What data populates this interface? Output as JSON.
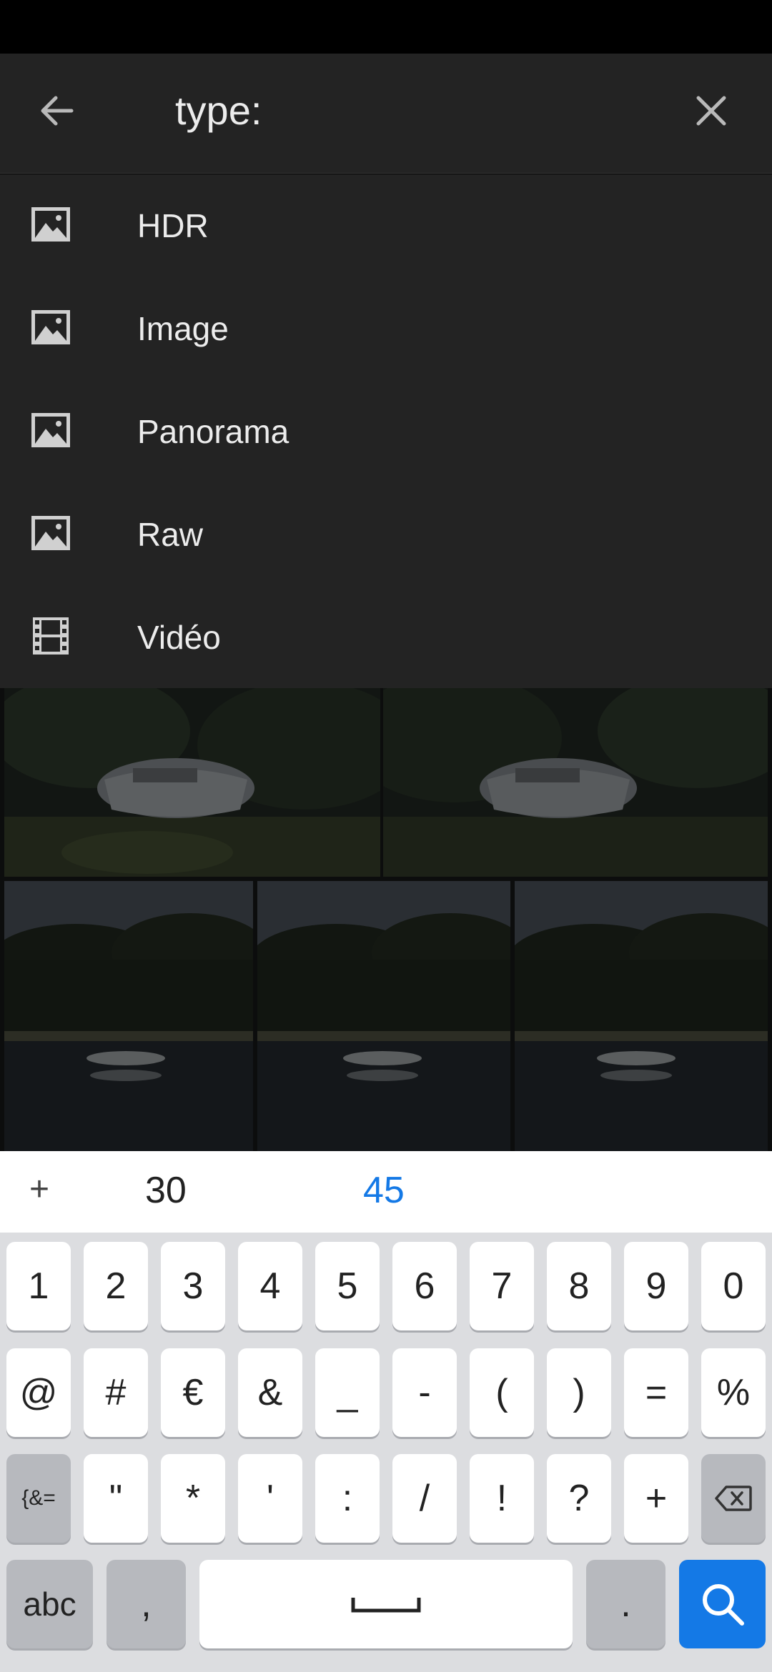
{
  "search": {
    "query": "type:",
    "back_icon": "arrow-left-icon",
    "clear_icon": "close-icon"
  },
  "suggestions": [
    {
      "label": "HDR",
      "icon": "image-icon"
    },
    {
      "label": "Image",
      "icon": "image-icon"
    },
    {
      "label": "Panorama",
      "icon": "image-icon"
    },
    {
      "label": "Raw",
      "icon": "image-icon"
    },
    {
      "label": "Vidéo",
      "icon": "film-icon"
    }
  ],
  "keyboard": {
    "suggestion_bar": {
      "plus": "+",
      "words": [
        "30",
        "45"
      ]
    },
    "row1": [
      "1",
      "2",
      "3",
      "4",
      "5",
      "6",
      "7",
      "8",
      "9",
      "0"
    ],
    "row2": [
      "@",
      "#",
      "€",
      "&",
      "_",
      "-",
      "(",
      ")",
      "=",
      "%"
    ],
    "row3": [
      "{&=",
      "\"",
      "*",
      "'",
      ":",
      "/",
      "!",
      "?",
      "+"
    ],
    "row4": {
      "abc": "abc",
      "comma": ",",
      "period": "."
    },
    "colors": {
      "accent": "#1479e6",
      "key": "#ffffff",
      "function_key": "#b7b9be"
    }
  }
}
